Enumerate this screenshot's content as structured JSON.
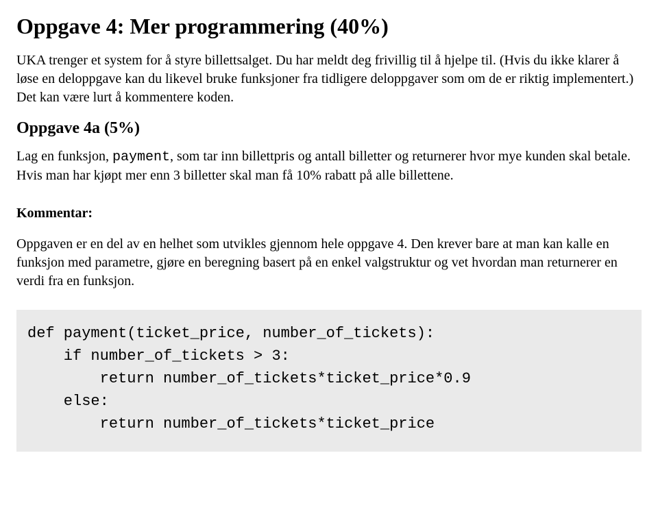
{
  "title": "Oppgave 4: Mer programmering (40%)",
  "intro": "UKA trenger et system for å styre billettsalget. Du har meldt deg frivillig til å hjelpe til. (Hvis du ikke klarer å løse en deloppgave kan du likevel bruke funksjoner fra tidligere deloppgaver som om de er riktig implementert.) Det kan være lurt å kommentere koden.",
  "subtask_title": "Oppgave 4a (5%)",
  "subtask_text_prefix": "Lag en funksjon, ",
  "subtask_code_word": "payment",
  "subtask_text_suffix": ", som tar inn billettpris og antall billetter og returnerer hvor mye kunden skal betale. Hvis man har kjøpt mer enn 3 billetter skal man få 10% rabatt på alle billettene.",
  "kommentar_label": "Kommentar:",
  "kommentar_text": "Oppgaven er en del av en helhet som utvikles gjennom hele oppgave 4. Den krever bare at man kan kalle en funksjon med parametre, gjøre en beregning basert på en enkel valgstruktur og vet hvordan man returnerer en verdi fra en funksjon.",
  "code": "def payment(ticket_price, number_of_tickets):\n    if number_of_tickets > 3:\n        return number_of_tickets*ticket_price*0.9\n    else:\n        return number_of_tickets*ticket_price"
}
